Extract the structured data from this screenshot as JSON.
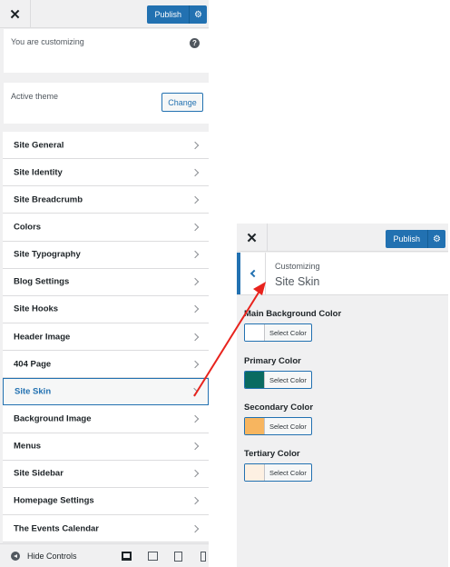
{
  "left_panel": {
    "close_symbol": "✕",
    "publish_label": "Publish",
    "settings_icon": "gear-icon",
    "customizing_text": "You are customizing",
    "help_symbol": "?",
    "active_theme_label": "Active theme",
    "change_label": "Change",
    "menu": [
      {
        "label": "Site General"
      },
      {
        "label": "Site Identity"
      },
      {
        "label": "Site Breadcrumb"
      },
      {
        "label": "Colors"
      },
      {
        "label": "Site Typography"
      },
      {
        "label": "Blog Settings"
      },
      {
        "label": "Site Hooks"
      },
      {
        "label": "Header Image"
      },
      {
        "label": "404 Page"
      },
      {
        "label": "Site Skin"
      },
      {
        "label": "Background Image"
      },
      {
        "label": "Menus"
      },
      {
        "label": "Site Sidebar"
      },
      {
        "label": "Homepage Settings"
      },
      {
        "label": "The Events Calendar"
      }
    ],
    "active_item": "Site Skin",
    "footer": {
      "hide_label": "Hide Controls",
      "devices": [
        "desktop-icon",
        "tablet-landscape-icon",
        "tablet-portrait-icon",
        "mobile-icon"
      ]
    }
  },
  "right_panel": {
    "close_symbol": "✕",
    "publish_label": "Publish",
    "customizing_label": "Customizing",
    "section_title": "Site Skin",
    "select_color_label": "Select Color",
    "colors": [
      {
        "label": "Main Background Color",
        "swatch": "#ffffff"
      },
      {
        "label": "Primary Color",
        "swatch": "#0a6b61"
      },
      {
        "label": "Secondary Color",
        "swatch": "#f7b55f"
      },
      {
        "label": "Tertiary Color",
        "swatch": "#fdf0e2"
      }
    ]
  },
  "theme_colors": {
    "accent": "#2271b1",
    "annotation_arrow": "#e8231d"
  }
}
